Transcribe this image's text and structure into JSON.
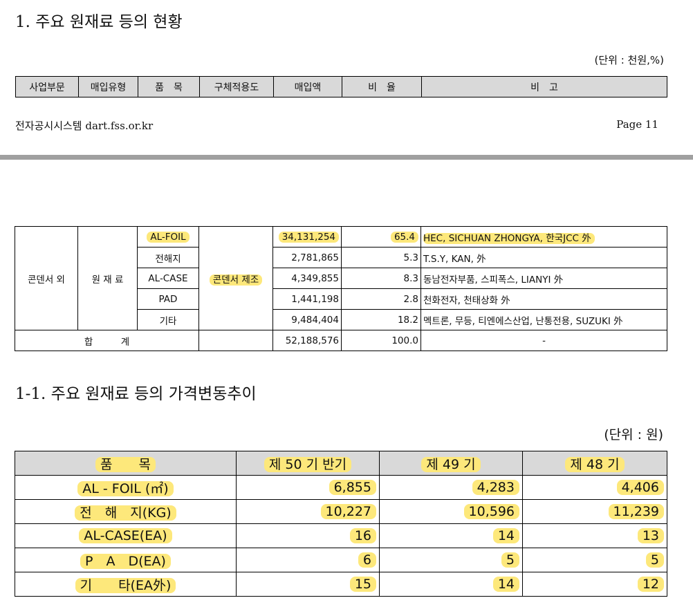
{
  "heading1": "1. 주요 원재료 등의 현황",
  "unit1": "(단위 : 천원,%)",
  "header_table": {
    "columns": [
      "사업부문",
      "매입유형",
      "품　목",
      "구체적용도",
      "매입액",
      "비　율",
      "비　고"
    ]
  },
  "footer": {
    "system": "전자공시시스템 dart.fss.or.kr",
    "page": "Page 11"
  },
  "main_table": {
    "segment": "콘덴서 외",
    "type": "원 재 료",
    "usage": "콘덴서 제조",
    "rows": [
      {
        "item": "AL-FOIL",
        "amount": "34,131,254",
        "ratio": "65.4",
        "note": "HEC, SICHUAN ZHONGYA, 한국JCC 外"
      },
      {
        "item": "전해지",
        "amount": "2,781,865",
        "ratio": "5.3",
        "note": "T.S.Y, KAN, 外"
      },
      {
        "item": "AL-CASE",
        "amount": "4,349,855",
        "ratio": "8.3",
        "note": "동남전자부품, 스피폭스, LIANYI 外"
      },
      {
        "item": "PAD",
        "amount": "1,441,198",
        "ratio": "2.8",
        "note": "천화전자, 천태상화 外"
      },
      {
        "item": "기타",
        "amount": "9,484,404",
        "ratio": "18.2",
        "note": "멕트론, 무등, 티엔에스산업, 난통전용, SUZUKI 外"
      }
    ],
    "total": {
      "label": "합　　　계",
      "amount": "52,188,576",
      "ratio": "100.0",
      "note": "-"
    }
  },
  "heading2": "1-1. 주요 원재료 등의 가격변동추이",
  "unit2": "(단위 : 원)",
  "price_table": {
    "columns": [
      "품　　목",
      "제 50 기 반기",
      "제 49 기",
      "제 48 기"
    ],
    "rows": [
      {
        "item": "AL - FOIL (㎡)",
        "v50": "6,855",
        "v49": "4,283",
        "v48": "4,406"
      },
      {
        "item": "전　해　지(KG)",
        "v50": "10,227",
        "v49": "10,596",
        "v48": "11,239"
      },
      {
        "item": "AL-CASE(EA)",
        "v50": "16",
        "v49": "14",
        "v48": "13"
      },
      {
        "item": "P　A　D(EA)",
        "v50": "6",
        "v49": "5",
        "v48": "5"
      },
      {
        "item": "기　　타(EA外)",
        "v50": "15",
        "v49": "14",
        "v48": "12"
      }
    ]
  },
  "colors": {
    "highlight": "#fde87b",
    "header_bg": "#d9d9d9",
    "divider": "#a0a0a0"
  }
}
